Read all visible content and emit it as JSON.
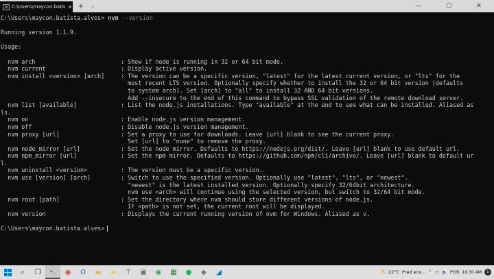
{
  "titlebar": {
    "tab_title": "C:\\Users\\maycon.batista.alves",
    "tab_close": "✕",
    "new_tab": "+",
    "tab_menu": "⌄",
    "minimize": "—",
    "maximize": "☐",
    "close": "✕"
  },
  "terminal": {
    "prompt": "C:\\Users\\maycon.batista.alves>",
    "command": "nvm",
    "command_args": "--version",
    "running": "Running version 1.1.9.",
    "usage_header": "Usage:",
    "usage": [
      {
        "cmd": "  nvm arch",
        "desc": [
          ": Show if node is running in 32 or 64 bit mode."
        ]
      },
      {
        "cmd": "  nvm current",
        "desc": [
          ": Display active version."
        ]
      },
      {
        "cmd": "  nvm install <version> [arch]",
        "desc": [
          ": The version can be a specific version, \"latest\" for the latest current version, or \"lts\" for the",
          "  most recent LTS version. Optionally specify whether to install the 32 or 64 bit version (defaults",
          "  to system arch). Set [arch] to \"all\" to install 32 AND 64 bit versions.",
          "  Add --insecure to the end of this command to bypass SSL validation of the remote download server."
        ]
      },
      {
        "cmd": "  nvm list [available]",
        "desc": [
          ": List the node.js installations. Type \"available\" at the end to see what can be installed. Aliased as"
        ],
        "wrap": "ls."
      },
      {
        "cmd": "  nvm on",
        "desc": [
          ": Enable node.js version management."
        ]
      },
      {
        "cmd": "  nvm off",
        "desc": [
          ": Disable node.js version management."
        ]
      },
      {
        "cmd": "  nvm proxy [url]",
        "desc": [
          ": Set a proxy to use for downloads. Leave [url] blank to see the current proxy.",
          "  Set [url] to \"none\" to remove the proxy."
        ]
      },
      {
        "cmd": "  nvm node_mirror [url]",
        "desc": [
          ": Set the node mirror. Defaults to https://nodejs.org/dist/. Leave [url] blank to use default url."
        ]
      },
      {
        "cmd": "  nvm npm_mirror [url]",
        "desc": [
          ": Set the npm mirror. Defaults to https://github.com/npm/cli/archive/. Leave [url] blank to default ur"
        ],
        "wrap": "l."
      },
      {
        "cmd": "  nvm uninstall <version>",
        "desc": [
          ": The version must be a specific version."
        ]
      },
      {
        "cmd": "  nvm use [version] [arch]",
        "desc": [
          ": Switch to use the specified version. Optionally use \"latest\", \"lts\", or \"newest\".",
          "  \"newest\" is the latest installed version. Optionally specify 32/64bit architecture.",
          "  nvm use <arch> will continue using the selected version, but switch to 32/64 bit mode."
        ]
      },
      {
        "cmd": "  nvm root [path]",
        "desc": [
          ": Set the directory where nvm should store different versions of node.js.",
          "  If <path> is not set, the current root will be displayed."
        ]
      },
      {
        "cmd": "  nvm version",
        "desc": [
          ": Displays the current running version of nvm for Windows. Aliased as v."
        ]
      }
    ],
    "final_prompt": "C:\\Users\\maycon.batista.alves>"
  },
  "taskbar": {
    "apps": [
      {
        "name": "search-app",
        "glyph": "⌕",
        "color": "#333333"
      },
      {
        "name": "taskview-app",
        "glyph": "❐",
        "color": "#333333"
      },
      {
        "name": "terminal-app",
        "glyph": ">_",
        "color": "#222222",
        "active": true
      },
      {
        "name": "chrome-app",
        "glyph": "◉",
        "color": "#db4437"
      },
      {
        "name": "outlook-app",
        "glyph": "O",
        "color": "#0a64ad"
      },
      {
        "name": "files-app",
        "glyph": "▬",
        "color": "#e8b339"
      },
      {
        "name": "explorer-app",
        "glyph": "▰",
        "color": "#f2c94c"
      },
      {
        "name": "teams-app",
        "glyph": "T",
        "color": "#5b5fc7"
      },
      {
        "name": "app-4",
        "glyph": "▣",
        "color": "#6a6a6a"
      },
      {
        "name": "chrome-app-2",
        "glyph": "◉",
        "color": "#34a853"
      },
      {
        "name": "app-6",
        "glyph": "▦",
        "color": "#2e7d32"
      },
      {
        "name": "spotify-app",
        "glyph": "●",
        "color": "#1db954"
      },
      {
        "name": "app-8",
        "glyph": "◆",
        "color": "#777777"
      },
      {
        "name": "vscode-app",
        "glyph": "◢",
        "color": "#007acc"
      }
    ],
    "weather_temp": "22°C",
    "weather_text": "Pred ens...",
    "language": "POR",
    "time": "10:30 AM",
    "notification_count": "1"
  }
}
